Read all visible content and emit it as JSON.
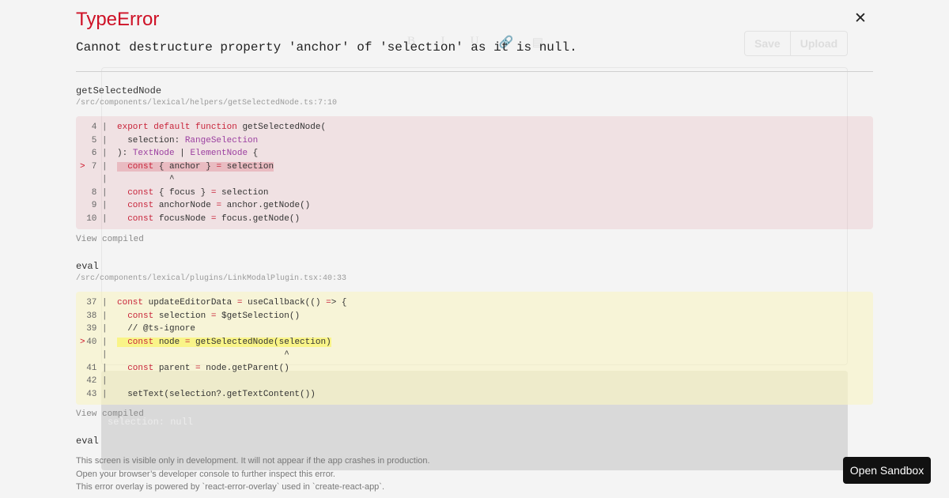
{
  "background": {
    "toolbar": [
      "B",
      "I",
      "U",
      "🔗",
      "▤"
    ],
    "actions": [
      "Save",
      "Upload"
    ],
    "panel_text": "selection: null"
  },
  "overlay": {
    "title": "TypeError",
    "close_glyph": "✕",
    "message": "Cannot destructure property 'anchor' of 'selection' as it is null.",
    "frames": [
      {
        "function": "getSelectedNode",
        "location": "/src/components/lexical/helpers/getSelectedNode.ts:7:10",
        "view_compiled": "View compiled",
        "lines": [
          {
            "no": "4",
            "code": "export default function getSelectedNode("
          },
          {
            "no": "5",
            "code": "  selection: RangeSelection"
          },
          {
            "no": "6",
            "code": "): TextNode | ElementNode {"
          },
          {
            "no": "7",
            "code": "  const { anchor } = selection",
            "marker": ">"
          },
          {
            "no": "",
            "code": "          ^"
          },
          {
            "no": "8",
            "code": "  const { focus } = selection"
          },
          {
            "no": "9",
            "code": "  const anchorNode = anchor.getNode()"
          },
          {
            "no": "10",
            "code": "  const focusNode = focus.getNode()"
          }
        ]
      },
      {
        "function": "eval",
        "location": "/src/components/lexical/plugins/LinkModalPlugin.tsx:40:33",
        "view_compiled": "View compiled",
        "lines": [
          {
            "no": "37",
            "code": "const updateEditorData = useCallback(() => {"
          },
          {
            "no": "38",
            "code": "  const selection = $getSelection()"
          },
          {
            "no": "39",
            "code": "  // @ts-ignore"
          },
          {
            "no": "40",
            "code": "  const node = getSelectedNode(selection)",
            "marker": ">"
          },
          {
            "no": "",
            "code": "                                ^"
          },
          {
            "no": "41",
            "code": "  const parent = node.getParent()"
          },
          {
            "no": "42",
            "code": ""
          },
          {
            "no": "43",
            "code": "  setText(selection?.getTextContent())"
          }
        ]
      },
      {
        "function": "eval",
        "location": "",
        "view_compiled": "",
        "lines": []
      }
    ]
  },
  "footer": {
    "line1": "This screen is visible only in development. It will not appear if the app crashes in production.",
    "line2": "Open your browser’s developer console to further inspect this error.",
    "line3": "This error overlay is powered by `react-error-overlay` used in `create-react-app`."
  },
  "sandbox_button": "Open Sandbox",
  "colors": {
    "error_red": "#ce1126",
    "keyword": "#c8243a",
    "type": "#9b3fa0",
    "red_block_bg": "#fbeaec",
    "yellow_block_bg": "#fbf8dc"
  }
}
